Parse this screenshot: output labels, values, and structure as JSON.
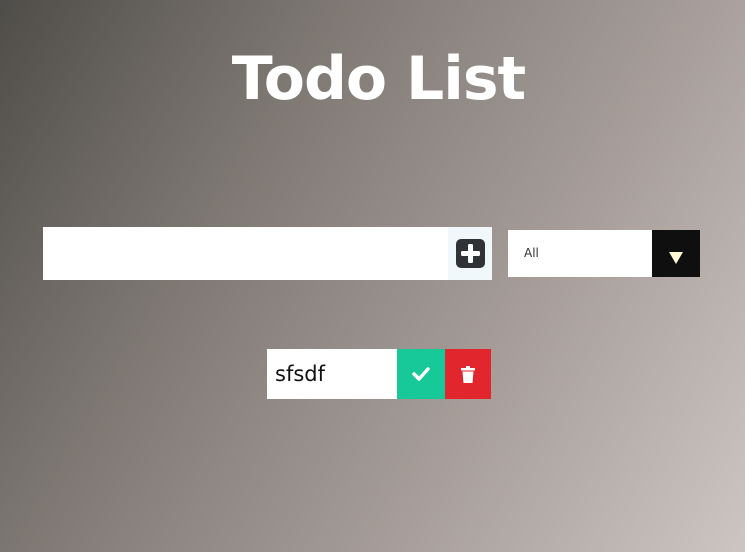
{
  "header": {
    "title": "Todo List"
  },
  "form": {
    "input_value": "",
    "add_icon": "plus-square-icon"
  },
  "filter": {
    "selected": "All",
    "arrow_icon": "caret-down-icon"
  },
  "todos": [
    {
      "text": "sfsdf",
      "complete_icon": "check-icon",
      "delete_icon": "trash-icon"
    }
  ],
  "colors": {
    "complete": "#17c898",
    "delete": "#e2262d",
    "select_arrow_bg": "#0f0f0f",
    "add_icon": "#2f3336"
  }
}
